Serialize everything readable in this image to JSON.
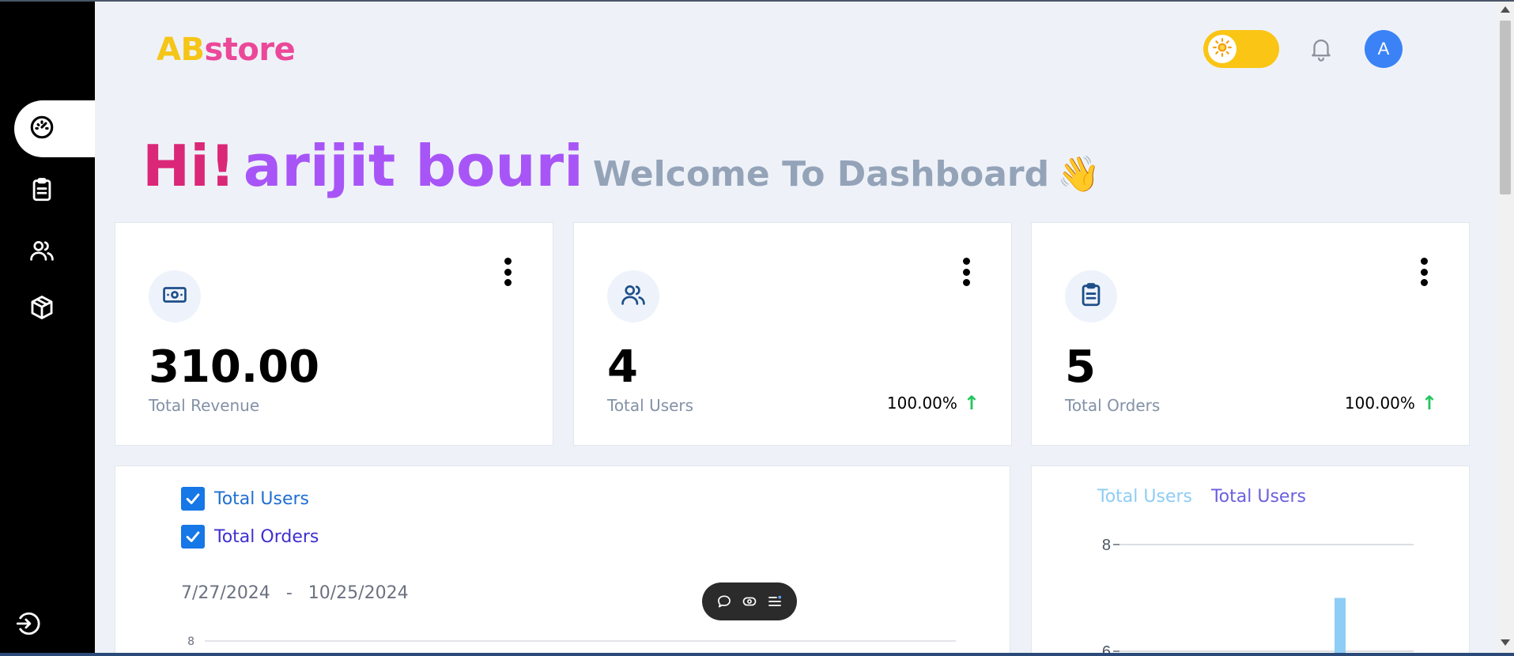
{
  "app": {
    "logo_part1": "AB",
    "logo_part2": "store"
  },
  "header": {
    "avatar_initial": "A",
    "theme_icon": "sun-icon",
    "notification_icon": "bell-icon"
  },
  "sidebar": {
    "items": [
      {
        "name": "dashboard",
        "icon": "dashboard-icon",
        "active": true
      },
      {
        "name": "orders",
        "icon": "clipboard-icon",
        "active": false
      },
      {
        "name": "users",
        "icon": "users-icon",
        "active": false
      },
      {
        "name": "products",
        "icon": "box-icon",
        "active": false
      }
    ],
    "logout_icon": "logout-icon"
  },
  "greeting": {
    "hi": "Hi!",
    "name": "arijit bouri",
    "welcome": "Welcome To Dashboard",
    "emoji": "👋"
  },
  "stats": [
    {
      "value": "310.00",
      "label": "Total Revenue",
      "change": "",
      "icon": "cash-icon"
    },
    {
      "value": "4",
      "label": "Total Users",
      "change": "100.00%",
      "icon": "users-icon"
    },
    {
      "value": "5",
      "label": "Total Orders",
      "change": "100.00%",
      "icon": "clipboard-icon"
    }
  ],
  "line_chart": {
    "legend": [
      "Total Users",
      "Total Orders"
    ],
    "date_start": "7/27/2024",
    "date_sep": "-",
    "date_end": "10/25/2024"
  },
  "bar_chart": {
    "legend": [
      "Total Users",
      "Total Users"
    ]
  },
  "colors": {
    "accent_yellow": "#fac515",
    "accent_pink": "#ec4899",
    "accent_purple": "#a855f7",
    "positive": "#22c55e",
    "avatar": "#3b82f6"
  },
  "chart_data": [
    {
      "type": "line",
      "series": [
        {
          "name": "Total Users",
          "values": []
        },
        {
          "name": "Total Orders",
          "values": []
        }
      ],
      "yticks": [
        8
      ],
      "title": "",
      "xlabel": "",
      "ylabel": ""
    },
    {
      "type": "bar",
      "series": [
        {
          "name": "Total Users",
          "values": [
            7
          ]
        },
        {
          "name": "Total Users",
          "values": []
        }
      ],
      "yticks": [
        8,
        6
      ],
      "ylim": [
        6,
        8
      ],
      "title": "",
      "xlabel": "",
      "ylabel": ""
    }
  ]
}
